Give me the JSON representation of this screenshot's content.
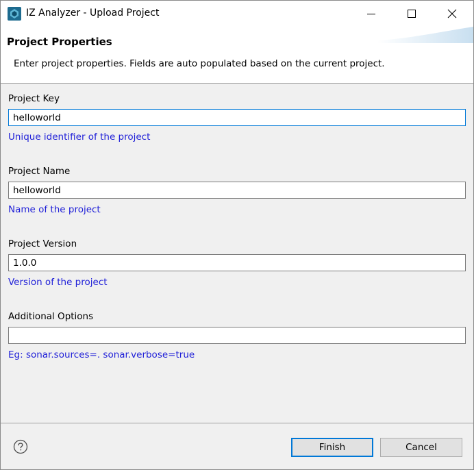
{
  "window": {
    "title": "IZ Analyzer - Upload Project",
    "icons": [
      "app-icon",
      "minimize-icon",
      "maximize-icon",
      "close-icon"
    ]
  },
  "header": {
    "title": "Project Properties",
    "description": "Enter project properties. Fields are auto populated based on the current project."
  },
  "fields": [
    {
      "label": "Project Key",
      "value": "helloworld",
      "help": "Unique identifier of the project"
    },
    {
      "label": "Project Name",
      "value": "helloworld",
      "help": "Name of the project"
    },
    {
      "label": "Project Version",
      "value": "1.0.0",
      "help": "Version of the project"
    },
    {
      "label": "Additional Options",
      "value": "",
      "help": "Eg: sonar.sources=. sonar.verbose=true"
    }
  ],
  "footer": {
    "help_icon": "help-icon",
    "finish_label": "Finish",
    "cancel_label": "Cancel"
  },
  "colors": {
    "help_text": "#1f1fd8",
    "focus_border": "#0078d7",
    "dialog_background": "#f0f0f0"
  }
}
